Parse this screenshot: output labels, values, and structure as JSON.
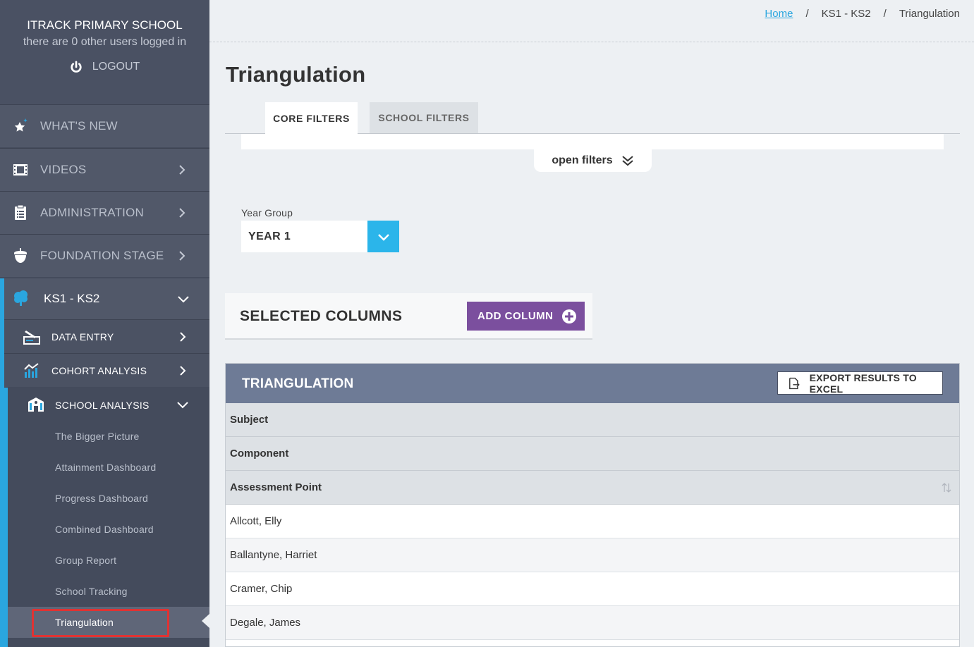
{
  "sidebar": {
    "school_name": "ITRACK PRIMARY SCHOOL",
    "users_online": "there are 0 other users logged in",
    "logout_label": "LOGOUT",
    "nav": {
      "whats_new": "WHAT'S NEW",
      "videos": "VIDEOS",
      "administration": "ADMINISTRATION",
      "foundation_stage": "FOUNDATION STAGE"
    },
    "ks": {
      "label": "KS1 - KS2",
      "data_entry": "DATA ENTRY",
      "cohort_analysis": "COHORT ANALYSIS",
      "school_analysis": "SCHOOL ANALYSIS",
      "items": [
        "The Bigger Picture",
        "Attainment Dashboard",
        "Progress Dashboard",
        "Combined Dashboard",
        "Group Report",
        "School Tracking",
        "Triangulation"
      ]
    }
  },
  "breadcrumb": {
    "home": "Home",
    "sep": "/",
    "section": "KS1 - KS2",
    "current": "Triangulation"
  },
  "page": {
    "title": "Triangulation",
    "tabs": [
      "CORE FILTERS",
      "SCHOOL FILTERS"
    ],
    "open_filters": "open filters",
    "year_group": {
      "label": "Year Group",
      "value": "YEAR 1"
    },
    "selected_columns": {
      "title": "SELECTED COLUMNS",
      "add_label": "ADD COLUMN"
    },
    "triangulation": {
      "title": "TRIANGULATION",
      "export_label": "EXPORT RESULTS TO EXCEL",
      "header_rows": [
        "Subject",
        "Component",
        "Assessment Point"
      ],
      "rows": [
        "Allcott, Elly",
        "Ballantyne, Harriet",
        "Cramer, Chip",
        "Degale, James"
      ]
    }
  },
  "colors": {
    "accent": "#2aa6df",
    "purple": "#7b4f9e",
    "table_header": "#6e7b96",
    "highlight": "#e03333"
  }
}
